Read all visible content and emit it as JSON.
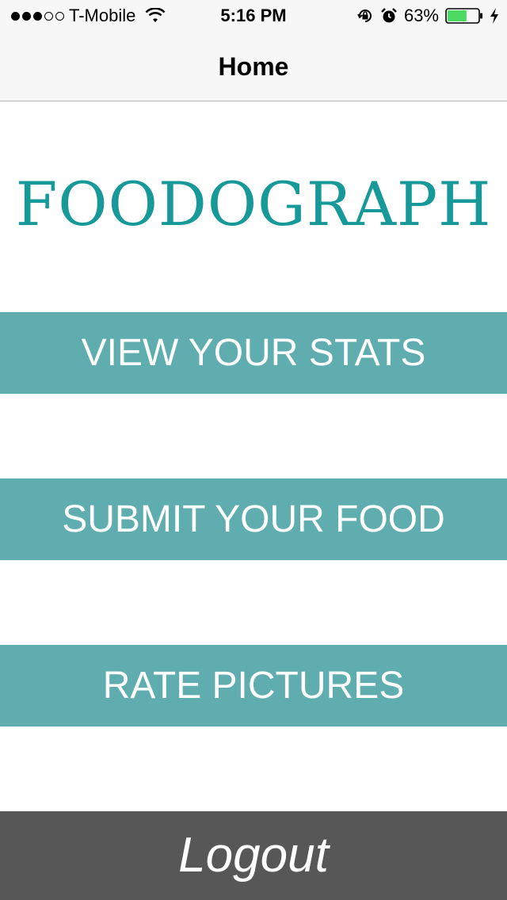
{
  "status_bar": {
    "signal_filled": 3,
    "signal_total": 5,
    "carrier": "T-Mobile",
    "time": "5:16 PM",
    "battery_percent": "63%",
    "battery_level": 0.63,
    "icons": [
      "wifi-icon",
      "rotation-lock-icon",
      "alarm-icon",
      "battery-icon",
      "charging-icon"
    ]
  },
  "nav": {
    "title": "Home"
  },
  "logo": {
    "text": "FOODOGRAPH"
  },
  "buttons": {
    "view_stats": "VIEW YOUR STATS",
    "submit_food": "SUBMIT YOUR FOOD",
    "rate_pictures": "RATE PICTURES",
    "logout": "Logout"
  },
  "colors": {
    "logo": "#17999a",
    "button_bg": "#5fadae",
    "logout_bg": "#575757",
    "battery_fill": "#4cd964"
  }
}
